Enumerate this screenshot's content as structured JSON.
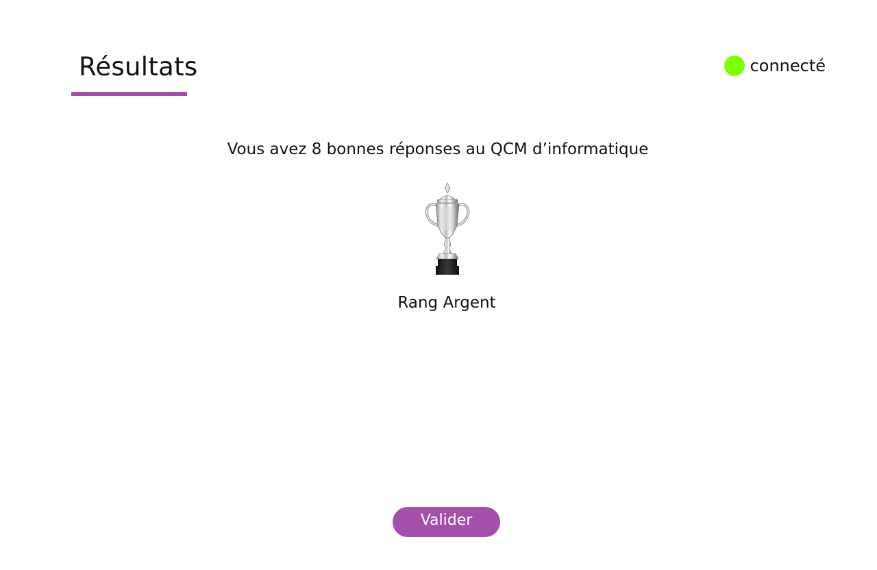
{
  "header": {
    "title": "Résultats",
    "accent_color": "#a44fa9"
  },
  "status": {
    "label": "connecté",
    "dot_color": "#7cff00"
  },
  "results": {
    "message": "Vous avez 8 bonnes réponses au QCM d’informatique",
    "trophy_icon": "silver-trophy-icon",
    "rank_label": "Rang Argent"
  },
  "footer": {
    "validate_label": "Valider"
  }
}
